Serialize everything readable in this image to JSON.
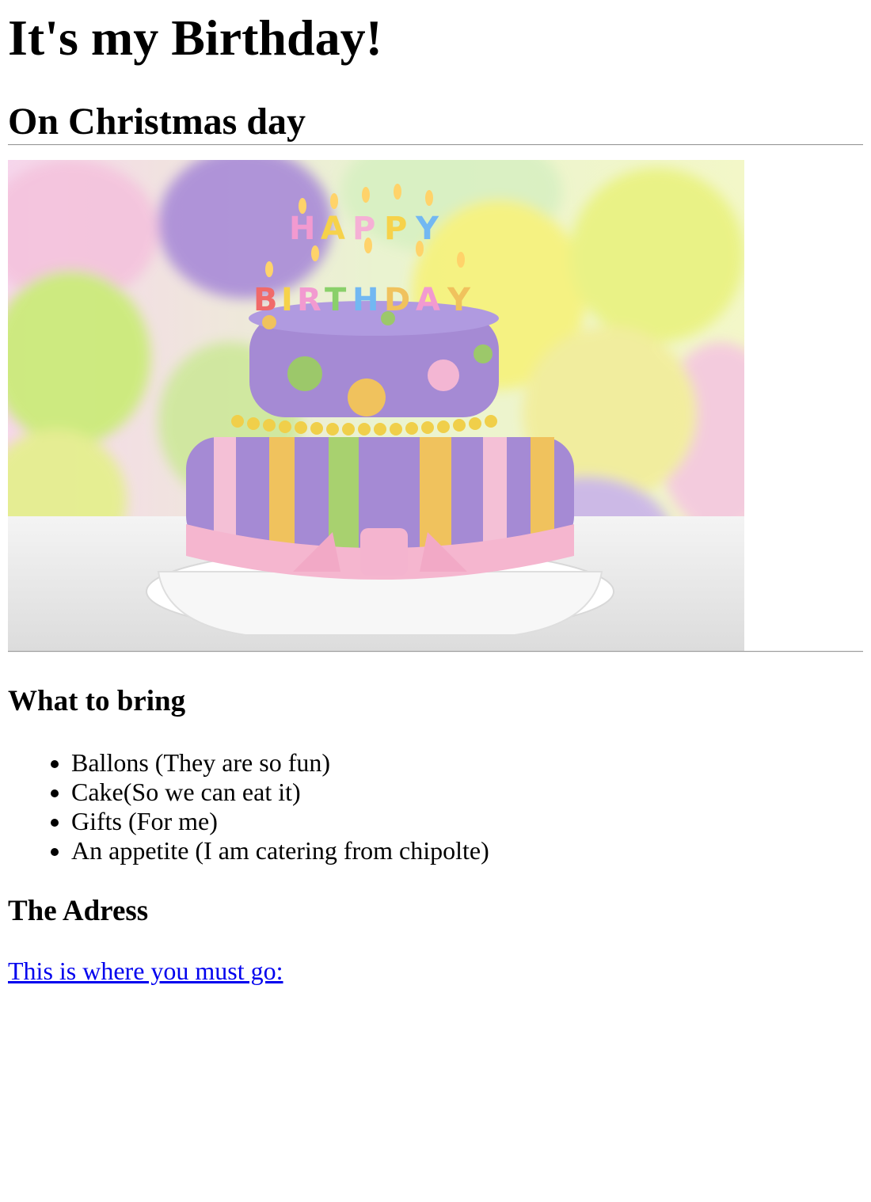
{
  "page": {
    "title": "It's my Birthday!",
    "subtitle": "On Christmas day"
  },
  "image": {
    "icon": "birthday-cake-photo",
    "colors": {
      "purple": "#9a86c9",
      "lime": "#c7e866",
      "yellow": "#f1f06a",
      "pink": "#f3b6d3",
      "gold": "#e9c24e",
      "green": "#9cc86a",
      "board": "#f2f2f2"
    }
  },
  "bring": {
    "heading": "What to bring",
    "items": [
      "Ballons (They are so fun)",
      "Cake(So we can eat it)",
      "Gifts (For me)",
      "An appetite (I am catering from chipolte)"
    ]
  },
  "address": {
    "heading": "The Adress",
    "link_text": "This is where you must go:",
    "link_color": "#0000ee"
  }
}
